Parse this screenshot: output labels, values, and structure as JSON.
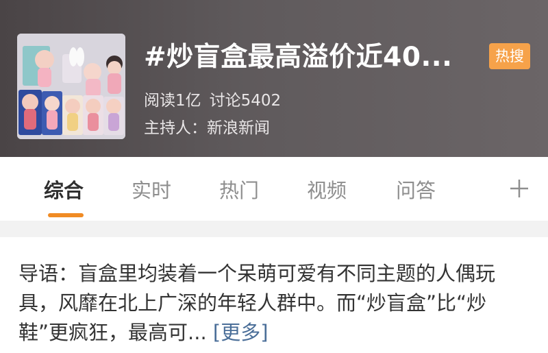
{
  "header": {
    "title": "#炒盲盒最高溢价近40...",
    "hot_badge": "热搜",
    "stats": {
      "reads": "阅读1亿",
      "discussions": "讨论5402"
    },
    "host": "主持人：新浪新闻"
  },
  "tabs": [
    {
      "label": "综合",
      "active": true
    },
    {
      "label": "实时",
      "active": false
    },
    {
      "label": "热门",
      "active": false
    },
    {
      "label": "视频",
      "active": false
    },
    {
      "label": "问答",
      "active": false
    }
  ],
  "intro": {
    "text": "导语：盲盒里均装着一个呆萌可爱有不同主题的人偶玩具，风靡在北上广深的年轻人群中。而“炒盲盒”比“炒鞋”更疯狂，最高可...",
    "more_label": "[更多]"
  },
  "colors": {
    "hot_badge": "#f6a24a",
    "tab_indicator": "#f08b24",
    "link": "#4a6e98"
  },
  "icons": {
    "add_tab": "plus-icon",
    "cover": "blind-box-figures-image"
  }
}
